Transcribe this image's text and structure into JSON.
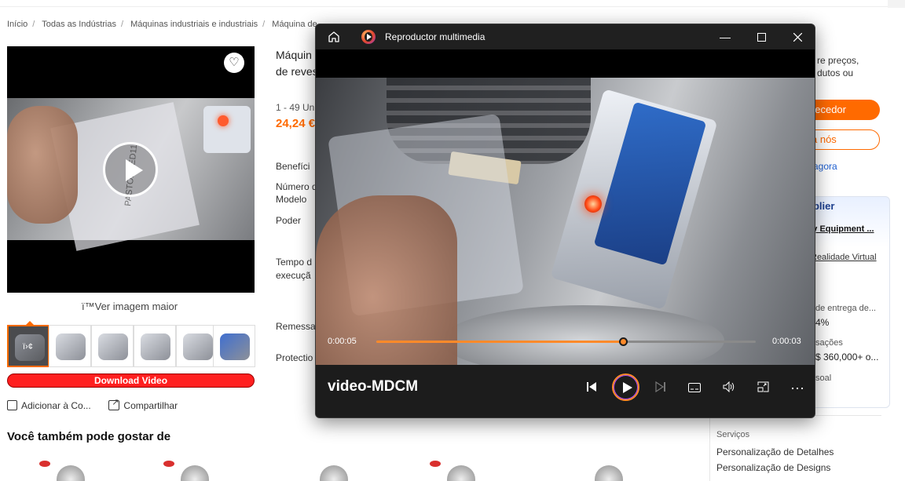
{
  "breadcrumb": [
    "Início",
    "Todas as Indústrias",
    "Máquinas industriais e industriais",
    "Máquina de"
  ],
  "left": {
    "view_larger": "ï™Ver imagem maior",
    "thumb_video_label": "ï›¢",
    "download_button": "Download Video",
    "add_compare": "Adicionar à Co...",
    "share": "Compartilhar",
    "also_like": "Você também pode gostar de",
    "bag_text": "PASTOF LED11"
  },
  "middle": {
    "title_line1": "Máquin",
    "title_line2": "de reves",
    "qty": "1 - 49 Un",
    "price": "24,24 €",
    "benefits": "Benefíci",
    "number": "Número d",
    "model": "Modelo",
    "power": "Poder",
    "lead_time_1": "Tempo d",
    "lead_time_2": "execuçã",
    "shipping": "Remessa",
    "protection": "Protectio"
  },
  "right": {
    "prices_1": "re preços,",
    "prices_2": "dutos ou",
    "contact_button": "necedor",
    "chat_button": "a nós",
    "visit_link": "agora",
    "supplier_title": "pplier",
    "supplier_name": "ry Equipment ...",
    "vr_link": "Realidade Virtual",
    "ontime_label": "de entrega de...",
    "ontime_value": "4%",
    "revenue_label": "sações",
    "revenue_value": "$ 360,000+ o...",
    "response_label": "soal",
    "services_label": "Serviços",
    "service_1": "Personalização de Detalhes",
    "service_2": "Personalização de Designs"
  },
  "player": {
    "app_title": "Reproductor multimedia",
    "video_title": "video-MDCM",
    "time_elapsed": "0:00:05",
    "time_remaining": "0:00:03",
    "progress_fraction": 0.65,
    "accent_color": "#ff8a2a",
    "icons": [
      "home-icon",
      "media-player-app-icon",
      "minimize-icon",
      "maximize-icon",
      "close-icon",
      "previous-icon",
      "play-icon",
      "next-icon",
      "subtitles-icon",
      "volume-icon",
      "mini-player-icon",
      "more-options-icon"
    ]
  },
  "colors": {
    "brand_orange": "#ff6a00",
    "download_red": "#ff1f1f",
    "link_blue": "#1d5fd1"
  }
}
